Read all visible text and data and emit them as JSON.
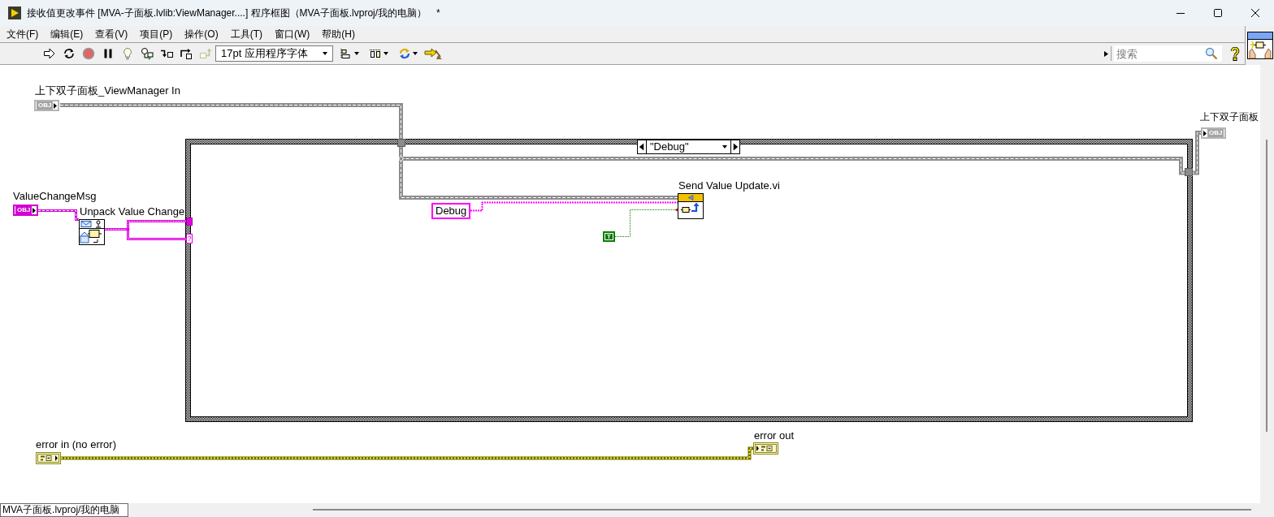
{
  "window": {
    "title": "接收值更改事件 [MVA-子面板.lvlib:ViewManager....] 程序框图（MVA子面板.lvproj/我的电脑）",
    "modified_mark": "*"
  },
  "menu": [
    "文件(F)",
    "编辑(E)",
    "查看(V)",
    "项目(P)",
    "操作(O)",
    "工具(T)",
    "窗口(W)",
    "帮助(H)"
  ],
  "toolbar": {
    "font": "17pt 应用程序字体",
    "search": {
      "placeholder": "搜索"
    }
  },
  "diagram": {
    "terminals": [
      {
        "label": "上下双子面板_ViewManager In",
        "kind": "object",
        "indicator": false,
        "glyph": "OBJ"
      },
      {
        "label": "ValueChangeMsg",
        "kind": "message",
        "indicator": false,
        "glyph": "OBJ"
      },
      {
        "label": "上下双子面板",
        "kind": "object",
        "indicator": true,
        "glyph": "OBJ"
      },
      {
        "label": "error in (no error)",
        "kind": "error",
        "indicator": false
      },
      {
        "label": "error out",
        "kind": "error",
        "indicator": true
      }
    ],
    "subvis": [
      {
        "label": "Unpack Value Change"
      },
      {
        "label": "Send Value Update.vi"
      }
    ],
    "constants": [
      {
        "kind": "string",
        "value": "Debug"
      },
      {
        "kind": "boolean",
        "value": "T"
      }
    ],
    "case_structure": {
      "selector": "\"Debug\"",
      "tunnels": [
        {
          "kind": "object"
        },
        {
          "kind": "message"
        },
        {
          "kind": "default",
          "glyph": "?"
        },
        {
          "kind": "object"
        }
      ]
    }
  },
  "status_bar": {
    "context": "MVA子面板.lvproj/我的电脑"
  }
}
